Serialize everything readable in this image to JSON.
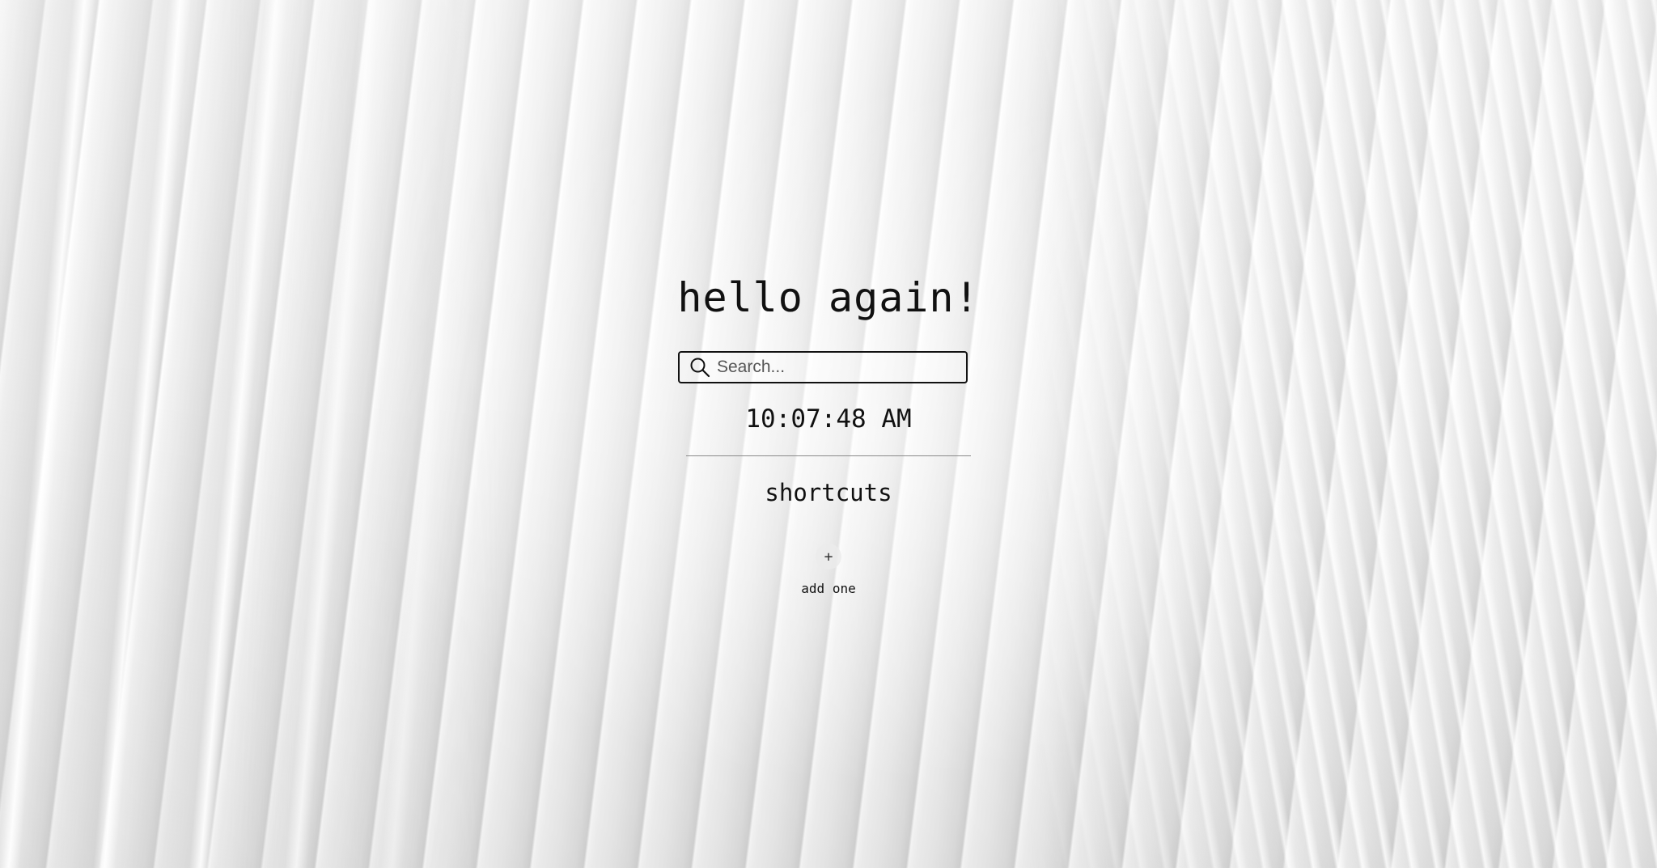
{
  "greeting": "hello again!",
  "search": {
    "placeholder": "Search...",
    "value": "",
    "icon": "magnifier"
  },
  "clock": {
    "time": "10:07:48 AM"
  },
  "shortcuts": {
    "title": "shortcuts",
    "add": {
      "icon": "+",
      "label": "add one"
    }
  }
}
